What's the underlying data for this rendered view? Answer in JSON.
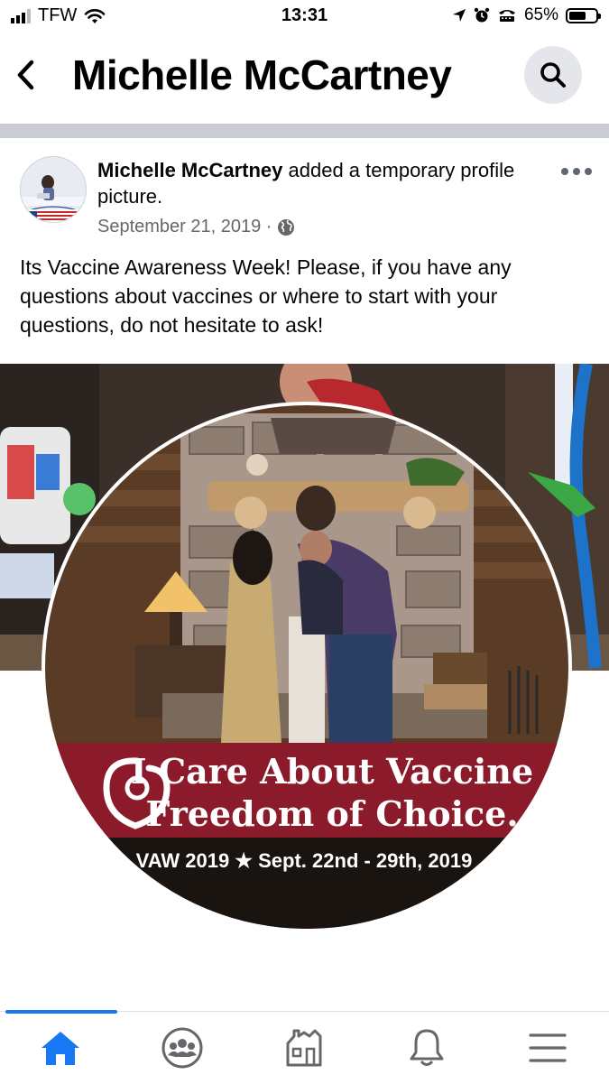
{
  "status_bar": {
    "carrier": "TFW",
    "time": "13:31",
    "battery": "65%",
    "battery_level": 0.65,
    "icons": [
      "signal-icon",
      "wifi-icon",
      "location-arrow-icon",
      "alarm-icon",
      "tty-icon",
      "battery-icon"
    ]
  },
  "header": {
    "title": "Michelle McCartney",
    "back_icon": "chevron-left-icon",
    "search_icon": "search-icon"
  },
  "post": {
    "author": "Michelle McCartney",
    "action": " added a temporary profile picture.",
    "date": "September 21, 2019 ·",
    "privacy_icon": "globe-icon",
    "more_icon": "more-horizontal-icon",
    "text": "Its Vaccine Awareness Week!  Please, if you have any questions about vaccines or where to start with your questions,  do not hesitate to ask!",
    "image": {
      "banner_line1": "I Care About Vaccine",
      "banner_line2": "Freedom of Choice.",
      "footer_text": "VAW 2019 ★ Sept. 22nd - 29th, 2019",
      "banner_color": "#8b1a2b"
    }
  },
  "tab_bar": {
    "accent_color": "#1877f2",
    "tabs": [
      {
        "name": "home",
        "icon": "home-icon",
        "active": true
      },
      {
        "name": "groups",
        "icon": "groups-icon",
        "active": false
      },
      {
        "name": "marketplace",
        "icon": "marketplace-icon",
        "active": false
      },
      {
        "name": "notifications",
        "icon": "bell-icon",
        "active": false
      },
      {
        "name": "menu",
        "icon": "menu-icon",
        "active": false
      }
    ]
  }
}
